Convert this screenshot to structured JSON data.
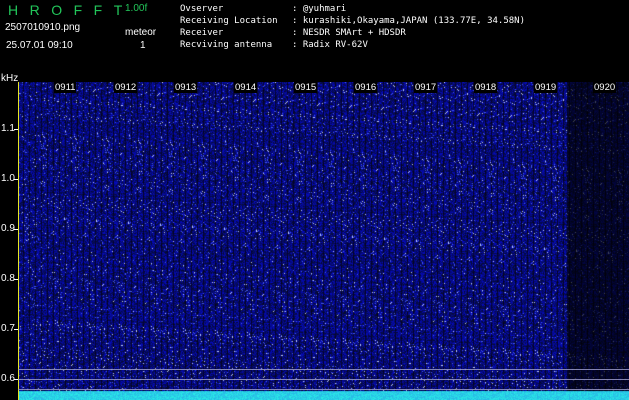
{
  "header": {
    "logo": "HROFFT",
    "version": "1.00f",
    "filename": "2507010910.png",
    "datetime": "25.07.01 09:10",
    "meteor_label": "meteor",
    "meteor_count": "1"
  },
  "info": [
    {
      "key": "Ovserver",
      "value": ": @yuhmari"
    },
    {
      "key": "Receiving Location",
      "value": ": kurashiki,Okayama,JAPAN (133.77E, 34.58N)"
    },
    {
      "key": "Receiver",
      "value": ": NESDR SMArt + HDSDR"
    },
    {
      "key": "Recviving antenna",
      "value": ": Radix RV-62V"
    }
  ],
  "axis": {
    "unit": "kHz",
    "y_labels": [
      "1.1",
      "1.0",
      "0.9",
      "0.8",
      "0.7",
      "0.6"
    ],
    "time_labels": [
      "0911",
      "0912",
      "0913",
      "0914",
      "0915",
      "0916",
      "0917",
      "0918",
      "0919",
      "0920"
    ]
  },
  "colors": {
    "accent": "#22c65a",
    "signal": "#1a2cd6",
    "marker": "#e6e620"
  }
}
